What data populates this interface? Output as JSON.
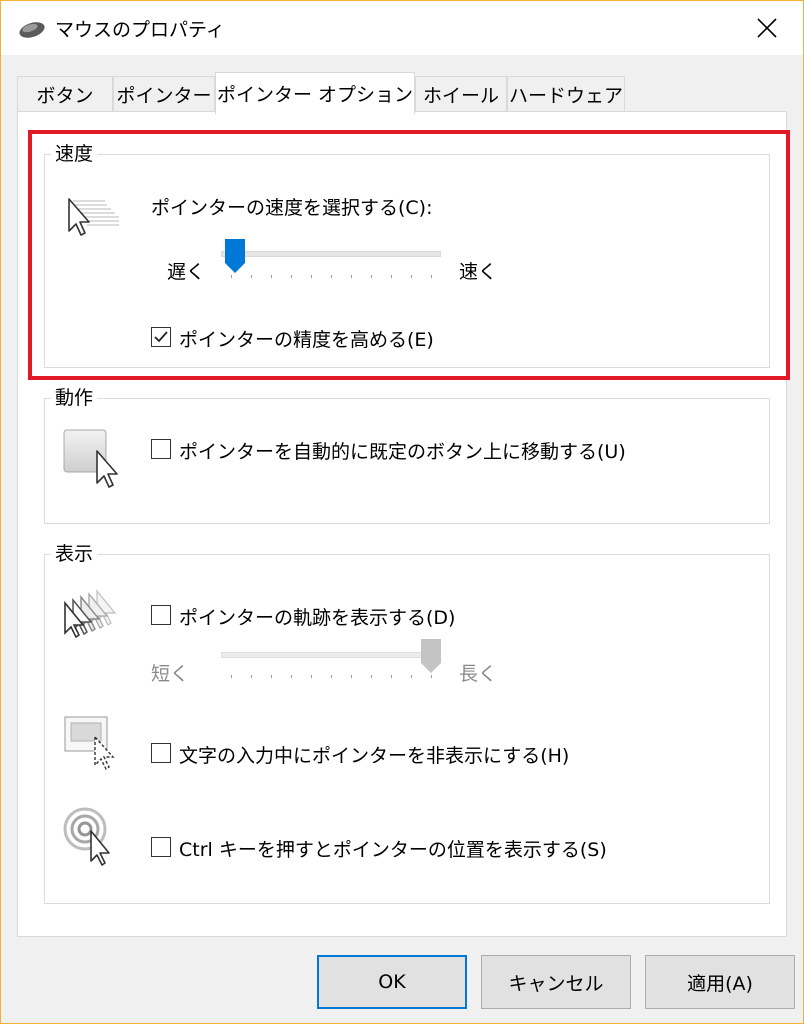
{
  "window": {
    "title": "マウスのプロパティ",
    "app_icon": "mouse-icon",
    "close_icon": "close-icon"
  },
  "tabs": [
    {
      "label": "ボタン",
      "active": false
    },
    {
      "label": "ポインター",
      "active": false
    },
    {
      "label": "ポインター オプション",
      "active": true
    },
    {
      "label": "ホイール",
      "active": false
    },
    {
      "label": "ハードウェア",
      "active": false
    }
  ],
  "speed": {
    "group_label": "速度",
    "select_label": "ポインターの速度を選択する(C):",
    "slow_label": "遅く",
    "fast_label": "速く",
    "slider_value": 0.02,
    "precision_label": "ポインターの精度を高める(E)",
    "precision_checked": true
  },
  "motion": {
    "group_label": "動作",
    "snap_label": "ポインターを自動的に既定のボタン上に移動する(U)",
    "snap_checked": false
  },
  "display": {
    "group_label": "表示",
    "trails_label": "ポインターの軌跡を表示する(D)",
    "trails_checked": false,
    "short_label": "短く",
    "long_label": "長く",
    "trails_value": 1.0,
    "hide_label": "文字の入力中にポインターを非表示にする(H)",
    "hide_checked": false,
    "ctrl_label": "Ctrl キーを押すとポインターの位置を表示する(S)",
    "ctrl_checked": false
  },
  "buttons": {
    "ok": "OK",
    "cancel": "キャンセル",
    "apply": "適用(A)"
  },
  "colors": {
    "highlight": "#e01a26",
    "accent": "#0078d7",
    "frame": "#f2b233"
  }
}
